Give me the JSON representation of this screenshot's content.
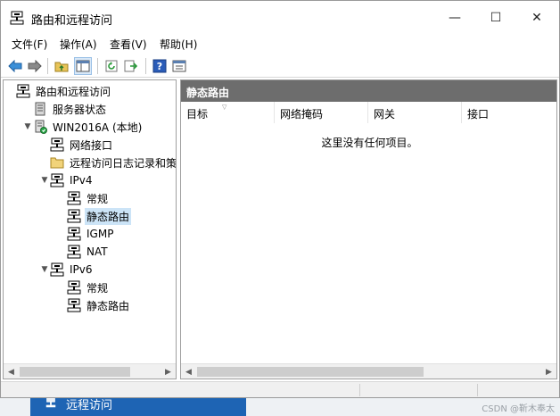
{
  "window": {
    "title": "路由和远程访问",
    "controls": {
      "minimize": "—",
      "maximize": "☐",
      "close": "✕"
    }
  },
  "menu": [
    "文件(F)",
    "操作(A)",
    "查看(V)",
    "帮助(H)"
  ],
  "toolbar": {
    "buttons": [
      "back-arrow-icon",
      "forward-arrow-icon",
      "up-folder-icon",
      "show-hide-tree-icon",
      "refresh-icon",
      "export-list-icon",
      "help-icon",
      "properties-icon"
    ]
  },
  "tree": {
    "items": [
      {
        "label": "路由和远程访问",
        "level": 0,
        "expander": "",
        "icon": "server-icon"
      },
      {
        "label": "服务器状态",
        "level": 1,
        "expander": "",
        "icon": "server-status-icon"
      },
      {
        "label": "WIN2016A (本地)",
        "level": 1,
        "expander": "▼",
        "icon": "server-local-icon"
      },
      {
        "label": "网络接口",
        "level": 2,
        "expander": "",
        "icon": "network-interface-icon"
      },
      {
        "label": "远程访问日志记录和策略",
        "level": 2,
        "expander": "",
        "icon": "folder-icon"
      },
      {
        "label": "IPv4",
        "level": 2,
        "expander": "▼",
        "icon": "routing-icon"
      },
      {
        "label": "常规",
        "level": 3,
        "expander": "",
        "icon": "routing-icon"
      },
      {
        "label": "静态路由",
        "level": 3,
        "expander": "",
        "icon": "routing-icon",
        "selected": true
      },
      {
        "label": "IGMP",
        "level": 3,
        "expander": "",
        "icon": "routing-icon"
      },
      {
        "label": "NAT",
        "level": 3,
        "expander": "",
        "icon": "routing-icon"
      },
      {
        "label": "IPv6",
        "level": 2,
        "expander": "▼",
        "icon": "routing-icon"
      },
      {
        "label": "常规",
        "level": 3,
        "expander": "",
        "icon": "routing-icon"
      },
      {
        "label": "静态路由",
        "level": 3,
        "expander": "",
        "icon": "routing-icon"
      }
    ]
  },
  "detail": {
    "header": "静态路由",
    "columns": [
      "目标",
      "网络掩码",
      "网关",
      "接口"
    ],
    "empty_message": "这里没有任何项目。"
  },
  "taskbar": {
    "item_label": "远程访问"
  },
  "watermark": "CSDN @靳木奉太",
  "colors": {
    "detail_header_bg": "#6d6d6d",
    "selection_bg": "#cce4f7",
    "taskbar_item_bg": "#1e64b4"
  }
}
